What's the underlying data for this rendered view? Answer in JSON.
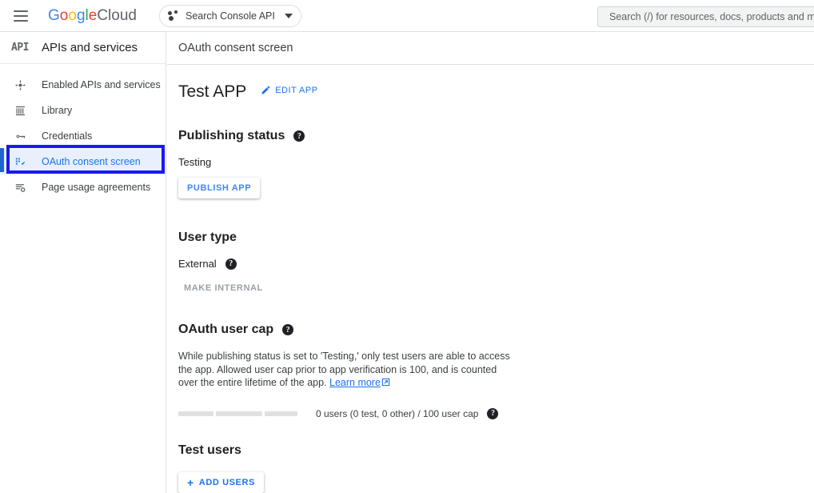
{
  "topbar": {
    "menu_icon": "hamburger-menu-icon",
    "brand": {
      "google": "Google",
      "cloud": "Cloud"
    },
    "project_selector": {
      "icon": "project-dots-icon",
      "label": "Search Console API",
      "caret_icon": "chevron-down-icon"
    },
    "search": {
      "placeholder": "Search (/) for resources, docs, products and mo",
      "value": ""
    }
  },
  "sidebar": {
    "logo_text": "API",
    "title": "APIs and services",
    "items": [
      {
        "label": "Enabled APIs and services",
        "icon": "enabled-apis-icon",
        "active": false
      },
      {
        "label": "Library",
        "icon": "library-icon",
        "active": false
      },
      {
        "label": "Credentials",
        "icon": "key-icon",
        "active": false
      },
      {
        "label": "OAuth consent screen",
        "icon": "oauth-consent-icon",
        "active": true
      },
      {
        "label": "Page usage agreements",
        "icon": "page-usage-icon",
        "active": false
      }
    ],
    "highlight_color": "#1a1aee",
    "active_color": "#1a73e8",
    "active_bg": "#e8f0fe"
  },
  "content": {
    "header_title": "OAuth consent screen",
    "app_name": "Test APP",
    "edit_app": {
      "label": "EDIT APP",
      "icon": "pencil-icon"
    },
    "publishing_status": {
      "heading": "Publishing status",
      "help_icon": "help-icon",
      "status": "Testing",
      "publish_button": "PUBLISH APP"
    },
    "user_type": {
      "heading": "User type",
      "value": "External",
      "help_icon": "help-icon",
      "make_internal_button": "MAKE INTERNAL"
    },
    "oauth_user_cap": {
      "heading": "OAuth user cap",
      "help_icon": "help-icon",
      "description_part1": "While publishing status is set to 'Testing,' only test users are able to access the app. Allowed user cap prior to app verification is 100, and is counted over the entire lifetime of the app. ",
      "learn_more": "Learn more",
      "learn_more_icon": "external-link-icon",
      "cap_text": "0 users (0 test, 0 other) / 100 user cap",
      "cap_help_icon": "help-icon",
      "progress_segments": 3,
      "progress_filled": 0
    },
    "test_users": {
      "heading": "Test users",
      "add_users_button": "ADD USERS",
      "add_icon": "plus-icon"
    }
  }
}
